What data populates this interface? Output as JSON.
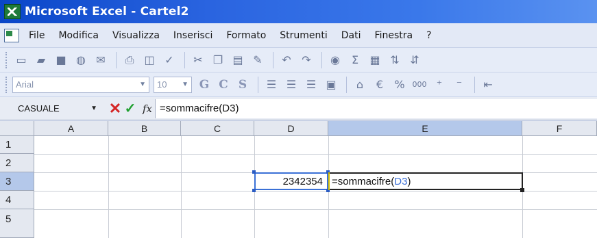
{
  "window": {
    "title": "Microsoft Excel - Cartel2"
  },
  "menu": {
    "items": [
      "File",
      "Modifica",
      "Visualizza",
      "Inserisci",
      "Formato",
      "Strumenti",
      "Dati",
      "Finestra",
      "?"
    ]
  },
  "toolbar_standard": {
    "icons": [
      "new-icon",
      "open-icon",
      "save-icon",
      "permission-icon",
      "email-icon",
      "print-icon",
      "print-preview-icon",
      "spelling-icon",
      "cut-icon",
      "copy-icon",
      "paste-icon",
      "format-painter-icon",
      "undo-icon",
      "redo-icon",
      "hyperlink-icon",
      "autosum-icon",
      "chart-wizard-icon",
      "sort-ascending-icon",
      "sort-descending-icon"
    ]
  },
  "toolbar_format": {
    "font": "Arial",
    "size": "10",
    "bold": "G",
    "italic": "C",
    "underline": "S",
    "currency_symbol": "€",
    "percent_symbol": "%",
    "thousands_symbol": "000"
  },
  "formula_bar": {
    "name_box": "CASUALE",
    "fx": "fx",
    "content": "=sommacifre(D3)"
  },
  "grid": {
    "columns": [
      "A",
      "B",
      "C",
      "D",
      "E",
      "F"
    ],
    "rows": [
      "1",
      "2",
      "3",
      "4",
      "5"
    ],
    "cells": {
      "D3": "2342354",
      "E3_prefix": "=sommacifre(",
      "E3_ref": "D3",
      "E3_suffix": ")"
    }
  },
  "colors": {
    "title_bar": "#0a46c8",
    "selection_ref": "#3a70d6",
    "cancel": "#d42424",
    "enter": "#20a030"
  }
}
